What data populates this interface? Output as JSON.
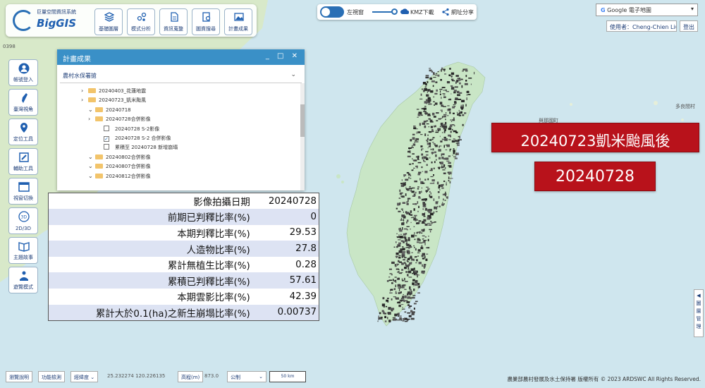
{
  "app": {
    "logo_sub": "巨量空間資訊系統",
    "logo_name": "BigGIS"
  },
  "toolbar": [
    {
      "label": "基礎圖層",
      "icon": "layers-icon"
    },
    {
      "label": "模式分析",
      "icon": "analysis-icon"
    },
    {
      "label": "資訊蒐整",
      "icon": "document-icon"
    },
    {
      "label": "圖資搜尋",
      "icon": "search-icon"
    },
    {
      "label": "計畫成果",
      "icon": "image-icon"
    }
  ],
  "top_controls": {
    "swipe_label": "左視窗",
    "kmz_label": "KMZ下載",
    "share_label": "網址分享"
  },
  "basemap": {
    "selected": "Google 電子地圖"
  },
  "user": {
    "label": "使用者：Cheng-Chien Liu",
    "logout": "登出"
  },
  "sidebar": [
    {
      "label": "帳號登入",
      "icon": "user-icon"
    },
    {
      "label": "臺灣視角",
      "icon": "taiwan-icon"
    },
    {
      "label": "定位工具",
      "icon": "location-icon"
    },
    {
      "label": "輔助工具",
      "icon": "tools-icon"
    },
    {
      "label": "視窗切換",
      "icon": "window-icon"
    },
    {
      "label": "2D/3D",
      "icon": "3d-icon"
    },
    {
      "label": "主題故事",
      "icon": "book-icon"
    },
    {
      "label": "遊覽模式",
      "icon": "tour-icon"
    }
  ],
  "plan_panel": {
    "title": "計畫成果",
    "selected_project": "農村水保署搶",
    "tree": [
      {
        "label": "20240403_花蓮地震",
        "type": "folder",
        "expanded": false,
        "level": 1
      },
      {
        "label": "20240723_凱米颱風",
        "type": "folder",
        "expanded": false,
        "level": 1
      },
      {
        "label": "20240718",
        "type": "folder",
        "expanded": true,
        "level": 2
      },
      {
        "label": "20240728合併影像",
        "type": "folder",
        "expanded": false,
        "level": 2
      },
      {
        "label": "20240728 S-2影像",
        "type": "check",
        "checked": false,
        "level": 3
      },
      {
        "label": "20240728 S-2 合併影像",
        "type": "check",
        "checked": true,
        "level": 3
      },
      {
        "label": "累積至 20240728 新增崩塌",
        "type": "check",
        "checked": false,
        "level": 3
      },
      {
        "label": "20240802合併影像",
        "type": "folder",
        "expanded": true,
        "level": 2
      },
      {
        "label": "20240807合併影像",
        "type": "folder",
        "expanded": true,
        "level": 2
      },
      {
        "label": "20240812合併影像",
        "type": "folder",
        "expanded": true,
        "level": 2
      }
    ]
  },
  "info_table": [
    {
      "key": "影像拍攝日期",
      "value": "20240728"
    },
    {
      "key": "前期已判釋比率(%)",
      "value": "0"
    },
    {
      "key": "本期判釋比率(%)",
      "value": "29.53"
    },
    {
      "key": "人造物比率(%)",
      "value": "27.8"
    },
    {
      "key": "累計無植生比率(%)",
      "value": "0.28"
    },
    {
      "key": "累積已判釋比率(%)",
      "value": "57.61"
    },
    {
      "key": "本期雲影比率(%)",
      "value": "42.39"
    },
    {
      "key": "累計大於0.1(ha)之新生崩塌比率(%)",
      "value": "0.00737"
    }
  ],
  "overlay_labels": {
    "event": "20240723凱米颱風後",
    "date": "20240728"
  },
  "bottom_bar": {
    "guide": "瀏覽說明",
    "feature": "功能檢測",
    "coord_label": "經緯度",
    "coords": "25.232274 120.226135",
    "elev_label": "高程(m)",
    "elev_value": "873.0",
    "unit": "公制",
    "scale": "50 km"
  },
  "side_tab": "◀ 圖層管理",
  "copyright": "農業部農村發展及水土保持署 版權所有 © 2023 ARDSWC All Rights Reserved.",
  "map_places": [
    "0398",
    "與那國町",
    "多良間村"
  ],
  "colors": {
    "accent": "#3a90c7",
    "label_red": "#b8121b",
    "land": "#c9e6c6",
    "sea": "#cfe6ee"
  }
}
